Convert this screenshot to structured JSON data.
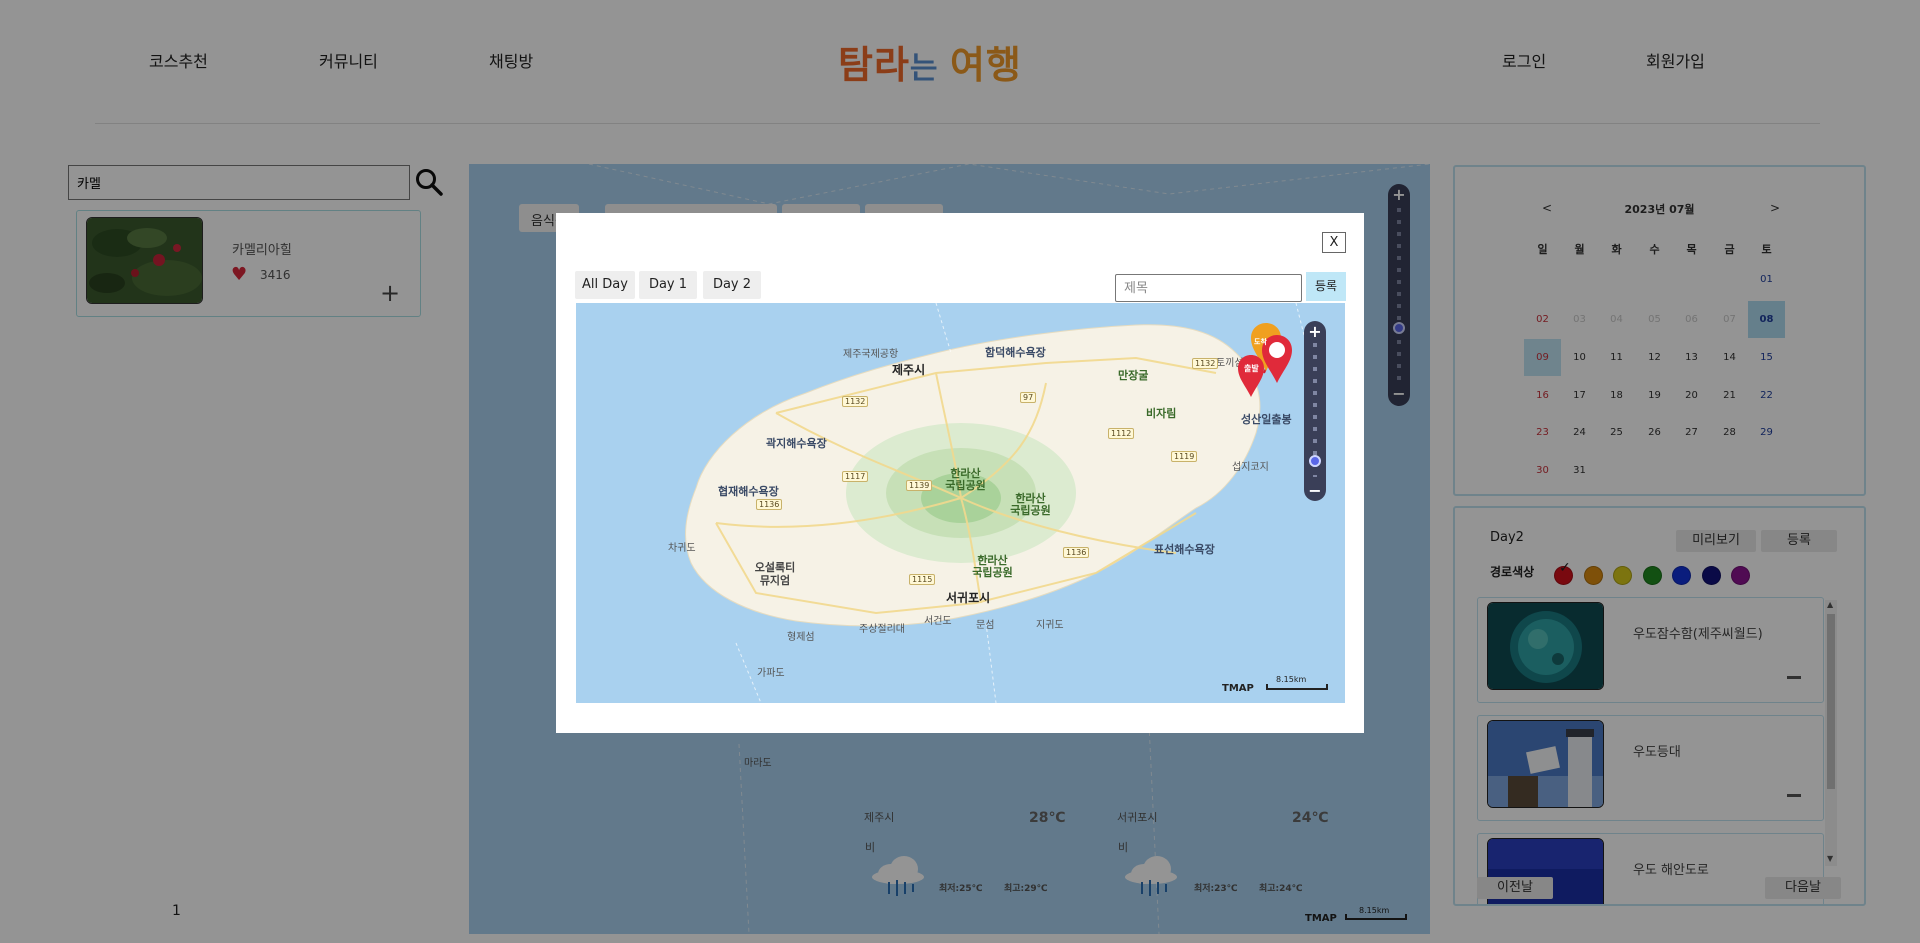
{
  "header": {
    "nav_left": [
      "코스추천",
      "커뮤니티",
      "채팅방"
    ],
    "logo": {
      "part1": "탐라",
      "part2": "는 ",
      "part3": "여행"
    },
    "nav_right": [
      "로그인",
      "회원가입"
    ]
  },
  "search": {
    "value": "카멜",
    "icon": "search-icon"
  },
  "results": [
    {
      "name": "카멜리아힐",
      "likes": "3416",
      "icon": "heart-icon",
      "add_icon": "plus-icon"
    }
  ],
  "pagination": {
    "current": "1"
  },
  "main_map": {
    "tabs": [
      "음식점"
    ],
    "weather": [
      {
        "city": "제주시",
        "desc": "비",
        "temp": "28℃",
        "low": "최저:25℃",
        "high": "최고:29℃"
      },
      {
        "city": "서귀포시",
        "desc": "비",
        "temp": "24℃",
        "low": "최저:23℃",
        "high": "최고:24℃"
      }
    ],
    "place_label": "마라도",
    "brand": "TMAP",
    "scale": "8.15km"
  },
  "calendar": {
    "title": "2023년 07월",
    "prev": "<",
    "next": ">",
    "weekdays": [
      "일",
      "월",
      "화",
      "수",
      "목",
      "금",
      "토"
    ],
    "weeks": [
      [
        "",
        "",
        "",
        "",
        "",
        "",
        "01"
      ],
      [
        "02",
        "03",
        "04",
        "05",
        "06",
        "07",
        "08"
      ],
      [
        "09",
        "10",
        "11",
        "12",
        "13",
        "14",
        "15"
      ],
      [
        "16",
        "17",
        "18",
        "19",
        "20",
        "21",
        "22"
      ],
      [
        "23",
        "24",
        "25",
        "26",
        "27",
        "28",
        "29"
      ],
      [
        "30",
        "31",
        "",
        "",
        "",
        "",
        ""
      ]
    ],
    "today": "08",
    "selected": "09"
  },
  "route_panel": {
    "day_title": "Day2",
    "preview_label": "미리보기",
    "register_label": "등록",
    "color_label": "경로색상",
    "colors": [
      "#d0101a",
      "#d98a10",
      "#d6c81a",
      "#1f8a1f",
      "#1232d8",
      "#12127a",
      "#8a138f"
    ],
    "selected_color_index": 0,
    "places": [
      {
        "name": "우도잠수함(제주씨월드)",
        "remove_icon": "minus-icon"
      },
      {
        "name": "우도등대",
        "remove_icon": "minus-icon"
      },
      {
        "name": "우도 해안도로",
        "remove_icon": "minus-icon"
      }
    ],
    "prev_day_label": "이전날",
    "next_day_label": "다음날"
  },
  "modal": {
    "close_label": "X",
    "tabs": [
      "All Day",
      "Day 1",
      "Day 2"
    ],
    "title_placeholder": "제목",
    "register_label": "등록",
    "map": {
      "brand": "TMAP",
      "scale": "8.15km",
      "labels": {
        "airport": "제주국제공항",
        "jeju_city": "제주시",
        "hamdeok": "함덕해수욕장",
        "manjanggul": "만장굴",
        "bijarim": "비자림",
        "toggle": "토끼섬",
        "seongsan": "성산일출봉",
        "seopjikoji": "섭지코지",
        "gwakji": "곽지해수욕장",
        "hyeopjae": "협재해수욕장",
        "hallasan1": "한라산\n국립공원",
        "hallasan2": "한라산\n국립공원",
        "hallasan3": "한라산\n국립공원",
        "chagwido": "차귀도",
        "osulloc": "오설록티\n뮤지엄",
        "seogwipo": "서귀포시",
        "pyoseon": "표선해수욕장",
        "jusangjeolli": "주상절리대",
        "seogeondo": "서건도",
        "munseom": "문섬",
        "jigwido": "지귀도",
        "hyeongjeseom": "형제섬",
        "gapado": "가파도"
      },
      "roads": [
        "1132",
        "97",
        "1112",
        "1117",
        "1139",
        "1136",
        "1119",
        "1115",
        "1136",
        "1132"
      ],
      "markers": [
        "출발",
        "도착"
      ]
    }
  }
}
